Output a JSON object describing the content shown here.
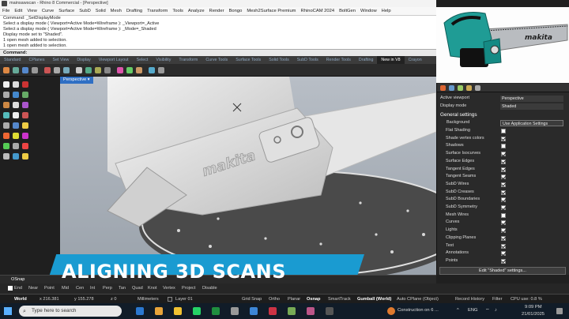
{
  "title": "mainsawscan - Rhino 8 Commercial - [Perspective]",
  "menu": [
    "File",
    "Edit",
    "View",
    "Curve",
    "Surface",
    "SubD",
    "Solid",
    "Mesh",
    "Drafting",
    "Transform",
    "Tools",
    "Analyze",
    "Render",
    "Bongo",
    "Mesh2Surface Premium",
    "RhinoCAM 2024",
    "BoltGen",
    "Window",
    "Help"
  ],
  "command_history": [
    "Command: _SetDisplayMode",
    "Select a display mode ( Viewport=Active  Mode=Wireframe ): _Viewport=_Active",
    "Select a display mode ( Viewport=Active  Mode=Wireframe ): _Mode=_Shaded",
    "Display mode set to \"Shaded\".",
    "1 open mesh added to selection.",
    "1 open mesh added to selection."
  ],
  "command_prompt": "Command:",
  "toolbar_tabs": [
    "Standard",
    "CPlanes",
    "Set View",
    "Display",
    "Viewport Layout",
    "Select",
    "Visibility",
    "Transform",
    "Curve Tools",
    "Surface Tools",
    "Solid Tools",
    "SubD Tools",
    "Render Tools",
    "Drafting",
    "New in V8",
    "Crayon"
  ],
  "active_tab": "New in V8",
  "viewport": {
    "label": "Perspective",
    "brand_mark": "makita"
  },
  "panel": {
    "active_viewport_label": "Active viewport",
    "active_viewport_value": "Perspective",
    "display_mode_label": "Display mode",
    "display_mode_value": "Shaded",
    "section": "General settings",
    "background_label": "Background",
    "background_value": "Use Application Settings",
    "items": [
      {
        "label": "Flat Shading",
        "checked": false
      },
      {
        "label": "Shade vertex colors",
        "checked": true
      },
      {
        "label": "Shadows",
        "checked": false
      },
      {
        "label": "Surface Isocurves",
        "checked": true
      },
      {
        "label": "Surface Edges",
        "checked": true
      },
      {
        "label": "Tangent Edges",
        "checked": true
      },
      {
        "label": "Tangent Seams",
        "checked": true
      },
      {
        "label": "SubD Wires",
        "checked": true
      },
      {
        "label": "SubD Creases",
        "checked": true
      },
      {
        "label": "SubD Boundaries",
        "checked": true
      },
      {
        "label": "SubD Symmetry",
        "checked": true
      },
      {
        "label": "Mesh Wires",
        "checked": false
      },
      {
        "label": "Curves",
        "checked": true
      },
      {
        "label": "Lights",
        "checked": true
      },
      {
        "label": "Clipping Planes",
        "checked": true
      },
      {
        "label": "Text",
        "checked": true
      },
      {
        "label": "Annotations",
        "checked": true
      },
      {
        "label": "Points",
        "checked": true
      }
    ],
    "edit_button": "Edit \"Shaded\" settings..."
  },
  "banner_text": "ALIGNING 3D SCANS",
  "osnap": {
    "label": "OSnap",
    "items": [
      "End",
      "Near",
      "Point",
      "Mid",
      "Cen",
      "Int",
      "Perp",
      "Tan",
      "Quad",
      "Knot",
      "Vertex",
      "Project",
      "Disable"
    ]
  },
  "status": {
    "cplane": "World",
    "x": "x 216.381",
    "y": "y 155.278",
    "z": "z 0",
    "units": "Millimeters",
    "layer": "Layer 01",
    "gridsnap": "Grid Snap",
    "ortho": "Ortho",
    "planar": "Planar",
    "osnap": "Osnap",
    "smarttrack": "SmartTrack",
    "gumball": "Gumball (World)",
    "autocplane": "Auto CPlane (Object)",
    "history": "Record History",
    "filter": "Filter",
    "cpu": "CPU use: 0.8 %"
  },
  "taskbar": {
    "search_placeholder": "Type here to search",
    "weather": "Construction on 6 ...",
    "lang": "ENG",
    "time": "9:09 PM",
    "date": "21/01/2025"
  },
  "colors": {
    "banner": "#1a9bd1",
    "accent": "#2f6fc4",
    "mesh": "#d9d9d9"
  }
}
